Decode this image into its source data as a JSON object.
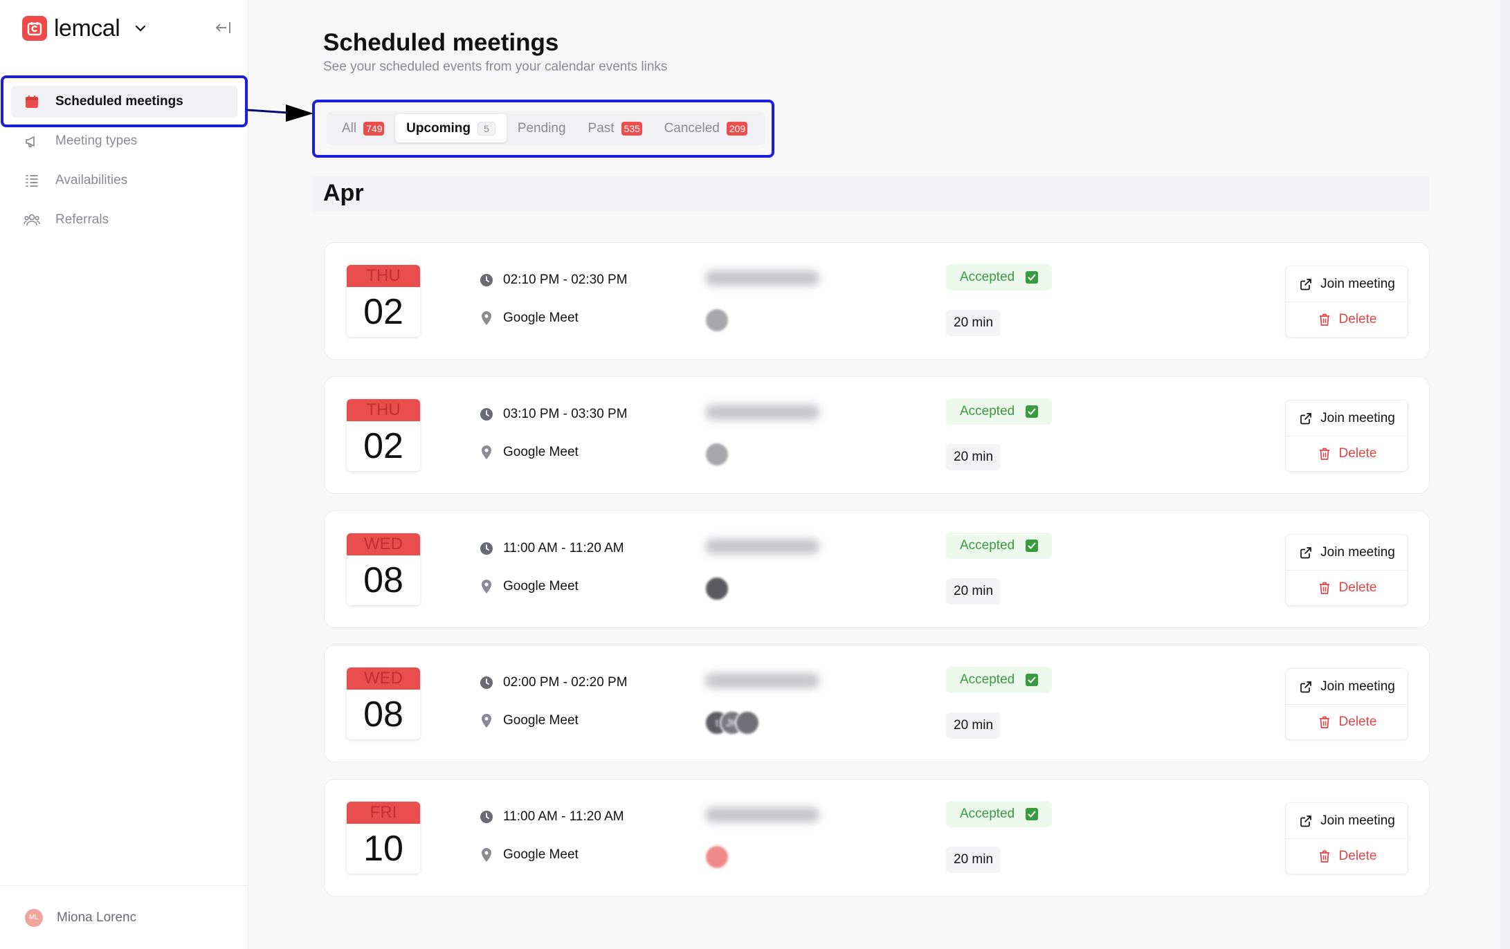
{
  "brand": {
    "name": "lemcal"
  },
  "sidebar": {
    "items": [
      {
        "label": "Scheduled meetings",
        "icon": "calendar-icon",
        "active": true
      },
      {
        "label": "Meeting types",
        "icon": "megaphone-icon",
        "active": false
      },
      {
        "label": "Availabilities",
        "icon": "list-icon",
        "active": false
      },
      {
        "label": "Referrals",
        "icon": "users-icon",
        "active": false
      }
    ],
    "user": {
      "initials": "ML",
      "name": "Miona Lorenc"
    }
  },
  "header": {
    "title": "Scheduled meetings",
    "subtitle": "See your scheduled events from your calendar events links"
  },
  "tabs": [
    {
      "label": "All",
      "count": "749"
    },
    {
      "label": "Upcoming",
      "count": "5"
    },
    {
      "label": "Pending",
      "count": ""
    },
    {
      "label": "Past",
      "count": "535"
    },
    {
      "label": "Canceled",
      "count": "209"
    }
  ],
  "month": "Apr",
  "meetings": [
    {
      "dow": "THU",
      "day": "02",
      "time": "02:10 PM - 02:30 PM",
      "location": "Google Meet",
      "status": "Accepted",
      "duration": "20 min",
      "join_label": "Join meeting",
      "delete_label": "Delete",
      "avatars": [
        ""
      ]
    },
    {
      "dow": "THU",
      "day": "02",
      "time": "03:10 PM - 03:30 PM",
      "location": "Google Meet",
      "status": "Accepted",
      "duration": "20 min",
      "join_label": "Join meeting",
      "delete_label": "Delete",
      "avatars": [
        ""
      ]
    },
    {
      "dow": "WED",
      "day": "08",
      "time": "11:00 AM - 11:20 AM",
      "location": "Google Meet",
      "status": "Accepted",
      "duration": "20 min",
      "join_label": "Join meeting",
      "delete_label": "Delete",
      "avatars": [
        ""
      ]
    },
    {
      "dow": "WED",
      "day": "08",
      "time": "02:00 PM - 02:20 PM",
      "location": "Google Meet",
      "status": "Accepted",
      "duration": "20 min",
      "join_label": "Join meeting",
      "delete_label": "Delete",
      "avatars": [
        "t",
        "JH",
        ""
      ]
    },
    {
      "dow": "FRI",
      "day": "10",
      "time": "11:00 AM - 11:20 AM",
      "location": "Google Meet",
      "status": "Accepted",
      "duration": "20 min",
      "join_label": "Join meeting",
      "delete_label": "Delete",
      "avatars": [
        ""
      ]
    }
  ],
  "colors": {
    "accent": "#ea4d4d",
    "highlight": "#1c1fd8",
    "success": "#3a9a3f",
    "danger": "#e24545"
  }
}
